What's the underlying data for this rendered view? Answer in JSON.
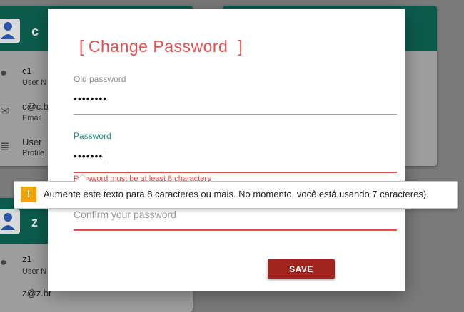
{
  "background_cards": [
    {
      "initial": "c",
      "username": "c1",
      "username_caption": "User N",
      "email": "c@c.b",
      "email_caption": "Email",
      "role": "User",
      "role_caption": "Profile"
    },
    {
      "initial": "z",
      "username": "z1",
      "username_caption": "User N",
      "email": "z@z.br"
    }
  ],
  "modal": {
    "title_open": "[",
    "title": "Change Password",
    "title_close": "]",
    "old_password": {
      "label": "Old password",
      "value": "••••••••"
    },
    "password": {
      "label": "Password",
      "value": "•••••••",
      "hint": "Password must be at least 8 characters"
    },
    "confirm_password": {
      "placeholder": "Confirm your password",
      "value": ""
    },
    "save_label": "SAVE"
  },
  "tooltip": {
    "icon": "!",
    "message": "Aumente este texto para 8 caracteres ou mais. No momento, você está usando 7 caracteres)."
  },
  "colors": {
    "accent": "#e14f4f",
    "active_label": "#1a8f83",
    "card_header": "#0b5b4d",
    "save_button": "#a1241f",
    "warning": "#f0a30a"
  }
}
